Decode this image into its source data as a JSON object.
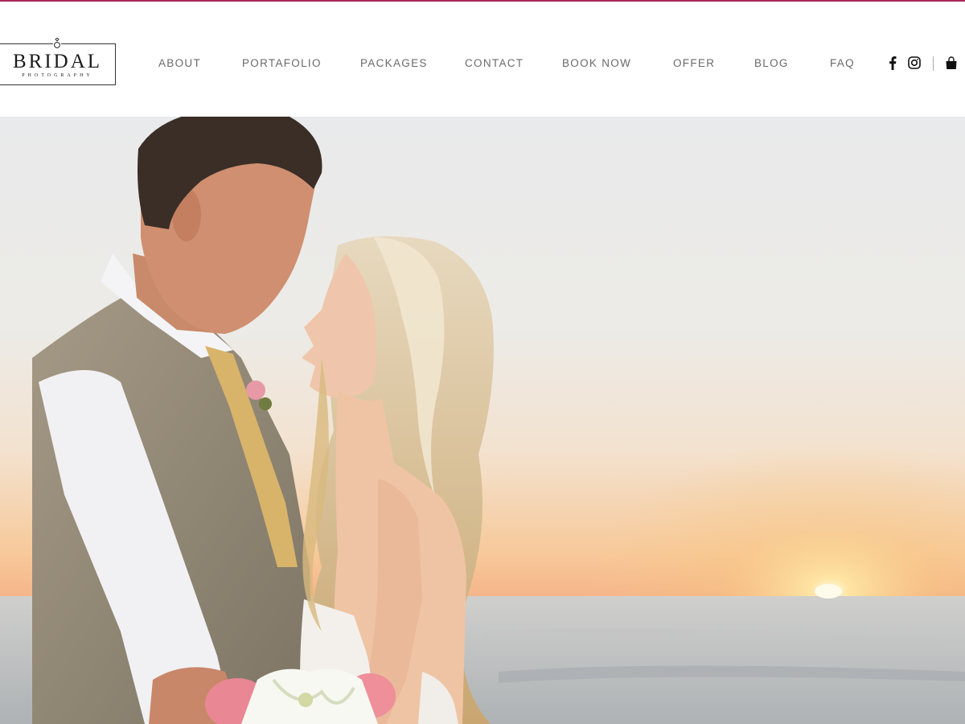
{
  "brand": {
    "name": "BRIDAL",
    "tagline": "PHOTOGRAPHY",
    "accent_color": "#a8285a"
  },
  "nav": {
    "items": [
      {
        "label": "ABOUT"
      },
      {
        "label": "PORTAFOLIO"
      },
      {
        "label": "PACKAGES"
      },
      {
        "label": "CONTACT"
      },
      {
        "label": "BOOK NOW"
      },
      {
        "label": "OFFER"
      },
      {
        "label": "BLOG"
      },
      {
        "label": "FAQ"
      }
    ]
  },
  "social": {
    "icons": [
      "facebook-icon",
      "instagram-icon",
      "shopping-bag-icon"
    ]
  },
  "hero": {
    "image": "bride-and-groom-beach-sunset-photo"
  }
}
